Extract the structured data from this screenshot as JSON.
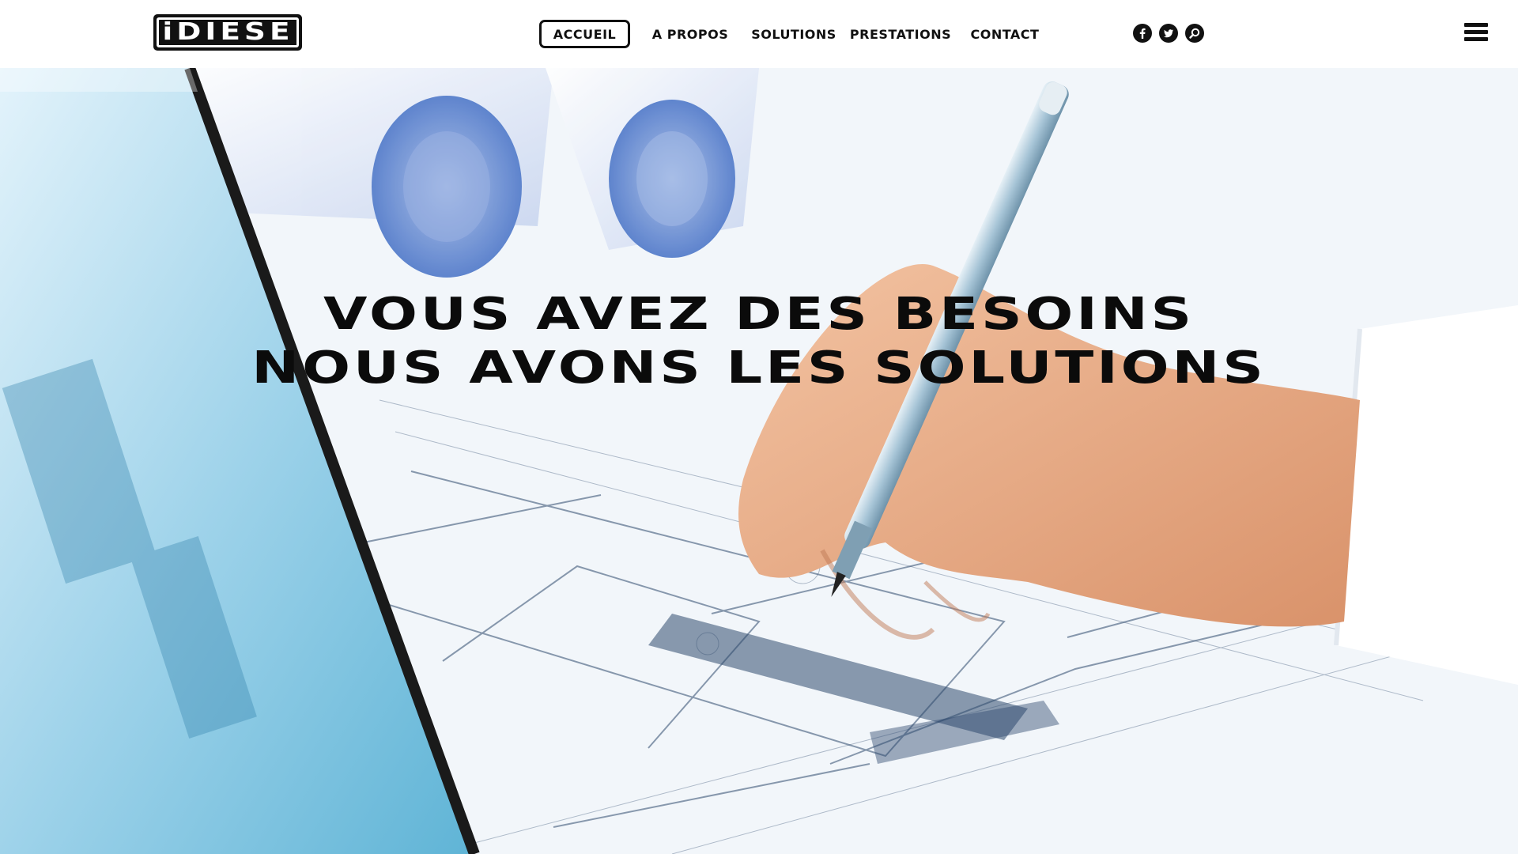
{
  "brand": {
    "logo_text": "iDIESE"
  },
  "nav": {
    "items": [
      {
        "label": "ACCUEIL",
        "active": true
      },
      {
        "label": "A PROPOS",
        "active": false
      },
      {
        "label": "SOLUTIONS",
        "active": false
      },
      {
        "label": "PRESTATIONS",
        "active": false
      },
      {
        "label": "CONTACT",
        "active": false
      }
    ]
  },
  "social": {
    "icons": [
      "facebook-icon",
      "twitter-icon",
      "search-icon"
    ]
  },
  "menu": {
    "icon": "hamburger-menu-icon"
  },
  "hero": {
    "line1": "VOUS AVEZ DES BESOINS",
    "line2": "NOUS AVONS LES SOLUTIONS"
  },
  "colors": {
    "text": "#111111",
    "background": "#ffffff",
    "hero_tint": "#e9f1f8",
    "blueprint_line": "#2f4a6e"
  }
}
